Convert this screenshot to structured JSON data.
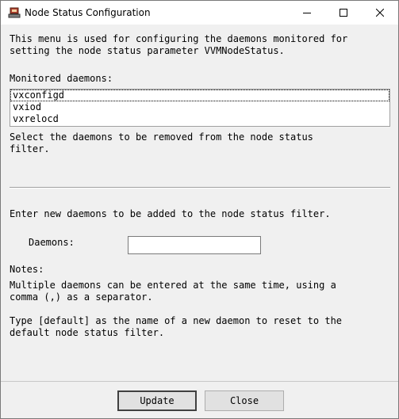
{
  "window": {
    "title": "Node Status Configuration",
    "icon": "app-icon",
    "controls": [
      "minimize-icon",
      "maximize-icon",
      "close-icon"
    ]
  },
  "intro": {
    "line1": "This menu is used for configuring the daemons monitored for",
    "line2": "setting the node status parameter VVMNodeStatus."
  },
  "monitored": {
    "label": "Monitored daemons:",
    "items": [
      "vxconfigd",
      "vxiod",
      "vxrelocd"
    ],
    "hint_line1": "Select the daemons to be removed from the node status",
    "hint_line2": "filter."
  },
  "add": {
    "instruction": "Enter new daemons to be added to the node status filter.",
    "field_label": "Daemons:",
    "field_value": ""
  },
  "notes": {
    "heading": "Notes:",
    "note1_line1": "Multiple daemons can be entered at the same time, using a",
    "note1_line2": "comma (,) as a separator.",
    "note2_line1": "Type [default] as the name of a new daemon to reset to the",
    "note2_line2": "default node status filter."
  },
  "buttons": {
    "update": "Update",
    "close": "Close"
  }
}
